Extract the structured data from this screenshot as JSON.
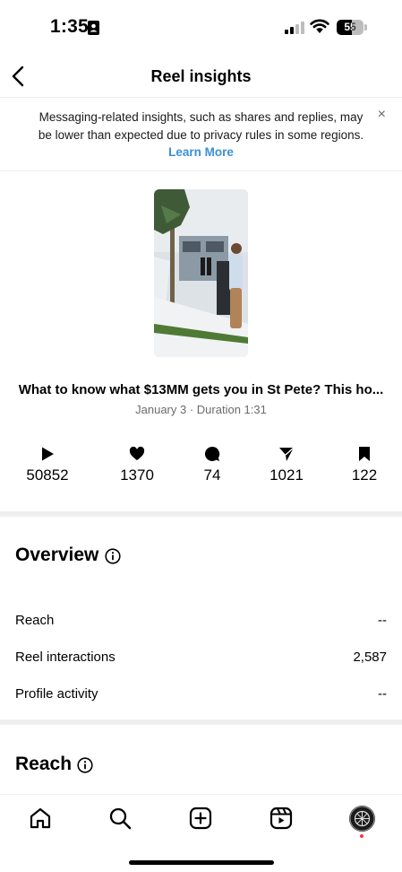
{
  "status_bar": {
    "time": "1:35",
    "battery": "55"
  },
  "header": {
    "title": "Reel insights"
  },
  "notice": {
    "message": "Messaging-related insights, such as shares and replies, may be lower than expected due to privacy rules in some regions.",
    "link_label": "Learn More",
    "close_label": "×"
  },
  "reel": {
    "title": "What to know what $13MM gets you in St Pete? This ho...",
    "meta": "January 3 · Duration 1:31"
  },
  "stats": {
    "plays": "50852",
    "likes": "1370",
    "comments": "74",
    "shares": "1021",
    "saves": "122"
  },
  "overview": {
    "heading": "Overview",
    "rows": [
      {
        "label": "Reach",
        "value": "--"
      },
      {
        "label": "Reel interactions",
        "value": "2,587"
      },
      {
        "label": "Profile activity",
        "value": "--"
      }
    ]
  },
  "reach": {
    "heading": "Reach"
  },
  "colors": {
    "link": "#3b8fd8",
    "notification_dot": "#ff3040",
    "divider": "#efefef"
  },
  "icons": [
    "contact-card-icon",
    "signal-icon",
    "wifi-icon",
    "battery-icon",
    "back-icon",
    "close-icon",
    "play-icon",
    "heart-icon",
    "comment-icon",
    "share-icon",
    "bookmark-icon",
    "info-icon",
    "home-icon",
    "search-icon",
    "create-icon",
    "reels-icon"
  ]
}
